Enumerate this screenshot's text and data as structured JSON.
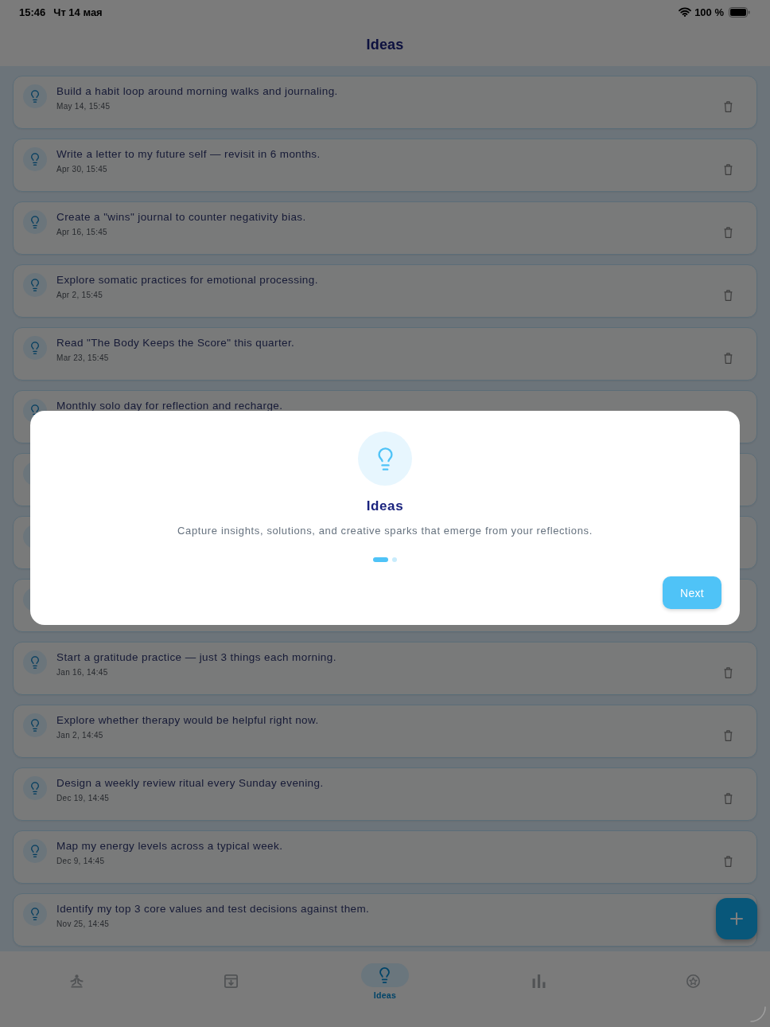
{
  "status_bar": {
    "time": "15:46",
    "date": "Чт 14 мая",
    "battery": "100 %"
  },
  "header": {
    "title": "Ideas"
  },
  "ideas": [
    {
      "kind": "idea",
      "title": "Build a habit loop around morning walks and journaling.",
      "date": "May 14, 15:45",
      "delete_icon": true
    },
    {
      "kind": "idea",
      "title": "Write a letter to my future self — revisit in 6 months.",
      "date": "Apr 30, 15:45",
      "delete_icon": true
    },
    {
      "kind": "idea",
      "title": "Create a \"wins\" journal to counter negativity bias.",
      "date": "Apr 16, 15:45",
      "delete_icon": true
    },
    {
      "kind": "idea",
      "title": "Explore somatic practices for emotional processing.",
      "date": "Apr 2, 15:45",
      "delete_icon": true
    },
    {
      "kind": "idea",
      "title": "Read \"The Body Keeps the Score\" this quarter.",
      "date": "Mar 23, 15:45",
      "delete_icon": true
    },
    {
      "kind": "idea",
      "title": "Monthly solo day for reflection and recharge."
    },
    {
      "kind": "covered"
    },
    {
      "kind": "covered"
    },
    {
      "kind": "covered"
    },
    {
      "kind": "idea",
      "title": "Start a gratitude practice — just 3 things each morning.",
      "date": "Jan 16, 14:45",
      "delete_icon": true
    },
    {
      "kind": "idea",
      "title": "Explore whether therapy would be helpful right now.",
      "date": "Jan 2, 14:45",
      "delete_icon": true
    },
    {
      "kind": "idea",
      "title": "Design a weekly review ritual every Sunday evening.",
      "date": "Dec 19, 14:45",
      "delete_icon": true
    },
    {
      "kind": "idea",
      "title": "Map my energy levels across a typical week.",
      "date": "Dec 9, 14:45",
      "delete_icon": true
    },
    {
      "kind": "idea",
      "title": "Identify my top 3 core values and test decisions against them.",
      "date": "Nov 25, 14:45"
    }
  ],
  "onboarding": {
    "title": "Ideas",
    "description": "Capture insights, solutions, and creative sparks that emerge from your reflections.",
    "pages": [
      {
        "selected": true
      },
      {
        "selected": false
      }
    ],
    "button": "Next"
  },
  "tab_bar": [
    {
      "kind": "meditation",
      "selected": false
    },
    {
      "kind": "archive",
      "selected": false
    },
    {
      "kind": "lightbulb",
      "selected": true,
      "label": "Ideas"
    },
    {
      "kind": "chart",
      "selected": false
    },
    {
      "kind": "star",
      "selected": false
    }
  ]
}
